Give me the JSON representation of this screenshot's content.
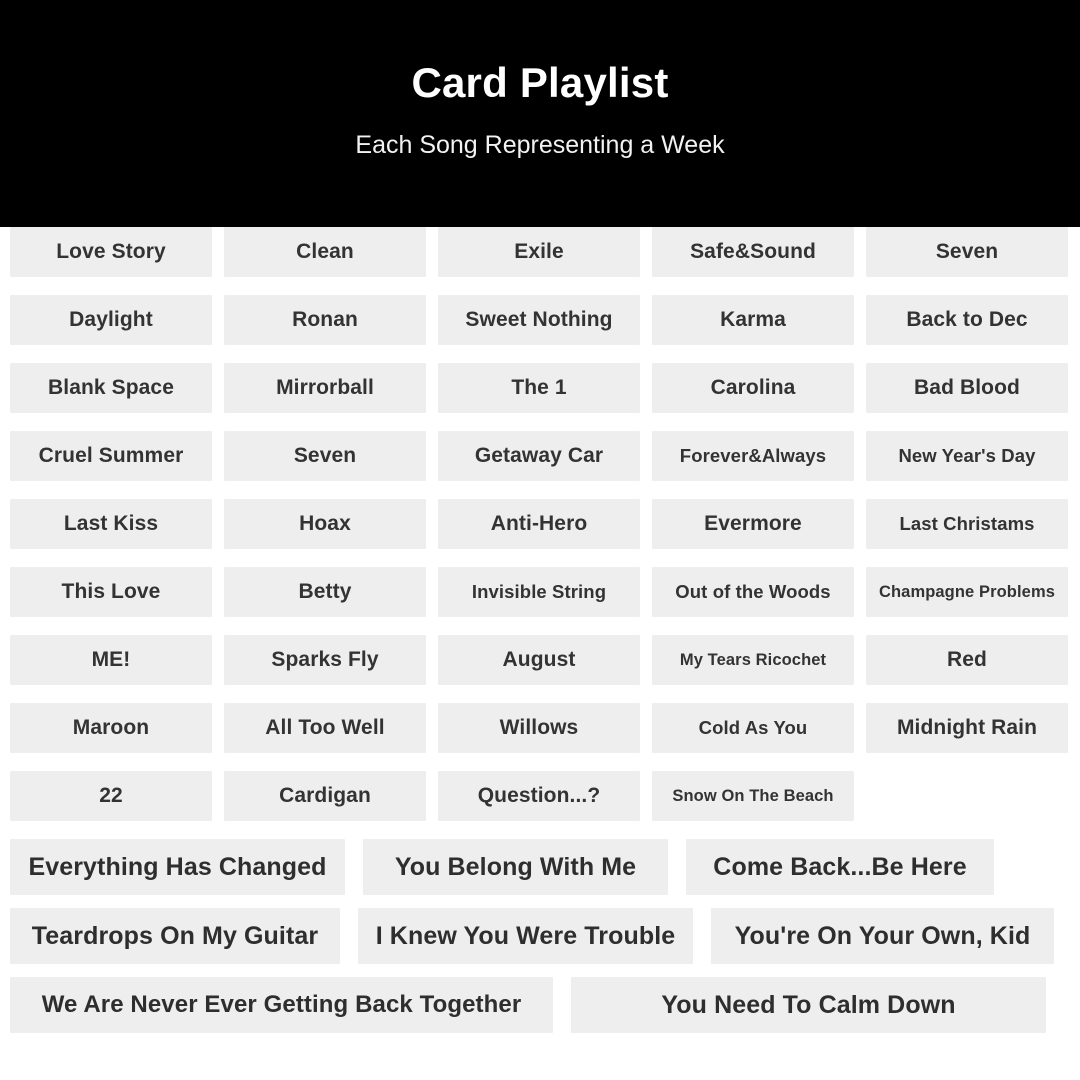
{
  "header": {
    "title": "Card Playlist",
    "subtitle": "Each Song Representing a Week"
  },
  "colors": {
    "header_background": "#000000",
    "header_text": "#ffffff",
    "page_background": "#ffffff",
    "card_background": "#eeeeee",
    "card_text": "#333333"
  },
  "grid": {
    "rows": [
      {
        "cards": [
          {
            "label": "Love Story",
            "size": "normal",
            "flex": 202
          },
          {
            "label": "Clean",
            "size": "normal",
            "flex": 202
          },
          {
            "label": "Exile",
            "size": "normal",
            "flex": 202
          },
          {
            "label": "Safe&Sound",
            "size": "normal",
            "flex": 202
          },
          {
            "label": "Seven",
            "size": "normal",
            "flex": 202
          }
        ]
      },
      {
        "cards": [
          {
            "label": "Daylight",
            "size": "normal",
            "flex": 202
          },
          {
            "label": "Ronan",
            "size": "normal",
            "flex": 202
          },
          {
            "label": "Sweet Nothing",
            "size": "normal",
            "flex": 202
          },
          {
            "label": "Karma",
            "size": "normal",
            "flex": 202
          },
          {
            "label": "Back to Dec",
            "size": "normal",
            "flex": 202
          }
        ]
      },
      {
        "cards": [
          {
            "label": "Blank Space",
            "size": "normal",
            "flex": 202
          },
          {
            "label": "Mirrorball",
            "size": "normal",
            "flex": 202
          },
          {
            "label": "The 1",
            "size": "normal",
            "flex": 202
          },
          {
            "label": "Carolina",
            "size": "normal",
            "flex": 202
          },
          {
            "label": "Bad Blood",
            "size": "normal",
            "flex": 202
          }
        ]
      },
      {
        "cards": [
          {
            "label": "Cruel Summer",
            "size": "normal",
            "flex": 202
          },
          {
            "label": "Seven",
            "size": "normal",
            "flex": 202
          },
          {
            "label": "Getaway Car",
            "size": "normal",
            "flex": 202
          },
          {
            "label": "Forever&Always",
            "size": "mid",
            "flex": 202
          },
          {
            "label": "New Year's Day",
            "size": "mid",
            "flex": 202
          }
        ]
      },
      {
        "cards": [
          {
            "label": "Last Kiss",
            "size": "normal",
            "flex": 202
          },
          {
            "label": "Hoax",
            "size": "normal",
            "flex": 202
          },
          {
            "label": "Anti-Hero",
            "size": "normal",
            "flex": 202
          },
          {
            "label": "Evermore",
            "size": "normal",
            "flex": 202
          },
          {
            "label": "Last Christams",
            "size": "mid",
            "flex": 202
          }
        ]
      },
      {
        "cards": [
          {
            "label": "This Love",
            "size": "normal",
            "flex": 202
          },
          {
            "label": "Betty",
            "size": "normal",
            "flex": 202
          },
          {
            "label": "Invisible String",
            "size": "mid",
            "flex": 202
          },
          {
            "label": "Out of the Woods",
            "size": "mid",
            "flex": 202
          },
          {
            "label": "Champagne Problems",
            "size": "small",
            "flex": 202
          }
        ]
      },
      {
        "cards": [
          {
            "label": "ME!",
            "size": "normal",
            "flex": 202
          },
          {
            "label": "Sparks Fly",
            "size": "normal",
            "flex": 202
          },
          {
            "label": "August",
            "size": "normal",
            "flex": 202
          },
          {
            "label": "My Tears Ricochet",
            "size": "small",
            "flex": 202
          },
          {
            "label": "Red",
            "size": "normal",
            "flex": 202
          }
        ]
      },
      {
        "cards": [
          {
            "label": "Maroon",
            "size": "normal",
            "flex": 202
          },
          {
            "label": "All Too Well",
            "size": "normal",
            "flex": 202
          },
          {
            "label": "Willows",
            "size": "normal",
            "flex": 202
          },
          {
            "label": "Cold As You",
            "size": "mid",
            "flex": 202
          },
          {
            "label": "Midnight Rain",
            "size": "normal",
            "flex": 202
          }
        ]
      },
      {
        "cards": [
          {
            "label": "22",
            "size": "normal",
            "flex": 202
          },
          {
            "label": "Cardigan",
            "size": "normal",
            "flex": 202
          },
          {
            "label": "Question...?",
            "size": "normal",
            "flex": 202
          },
          {
            "label": "Snow On The Beach",
            "size": "small",
            "flex": 202
          },
          {
            "label": "",
            "size": "empty",
            "flex": 202
          }
        ]
      },
      {
        "wide": true,
        "cards": [
          {
            "label": "Everything Has Changed",
            "size": "wide",
            "flex": 335
          },
          {
            "label": "You Belong With Me",
            "size": "wide",
            "flex": 305
          },
          {
            "label": "Come Back...Be Here",
            "size": "wide",
            "flex": 308
          }
        ]
      },
      {
        "wide": true,
        "cards": [
          {
            "label": "Teardrops On My Guitar",
            "size": "wide",
            "flex": 330
          },
          {
            "label": "I Knew You Were Trouble",
            "size": "wide",
            "flex": 335
          },
          {
            "label": "You're On Your Own, Kid",
            "size": "wide",
            "flex": 343
          }
        ]
      },
      {
        "wide": true,
        "last": true,
        "cards": [
          {
            "label": "We Are Never Ever Getting Back Together",
            "size": "wide-tight",
            "flex": 543
          },
          {
            "label": "You Need To Calm Down",
            "size": "wide",
            "flex": 475
          }
        ]
      }
    ]
  }
}
